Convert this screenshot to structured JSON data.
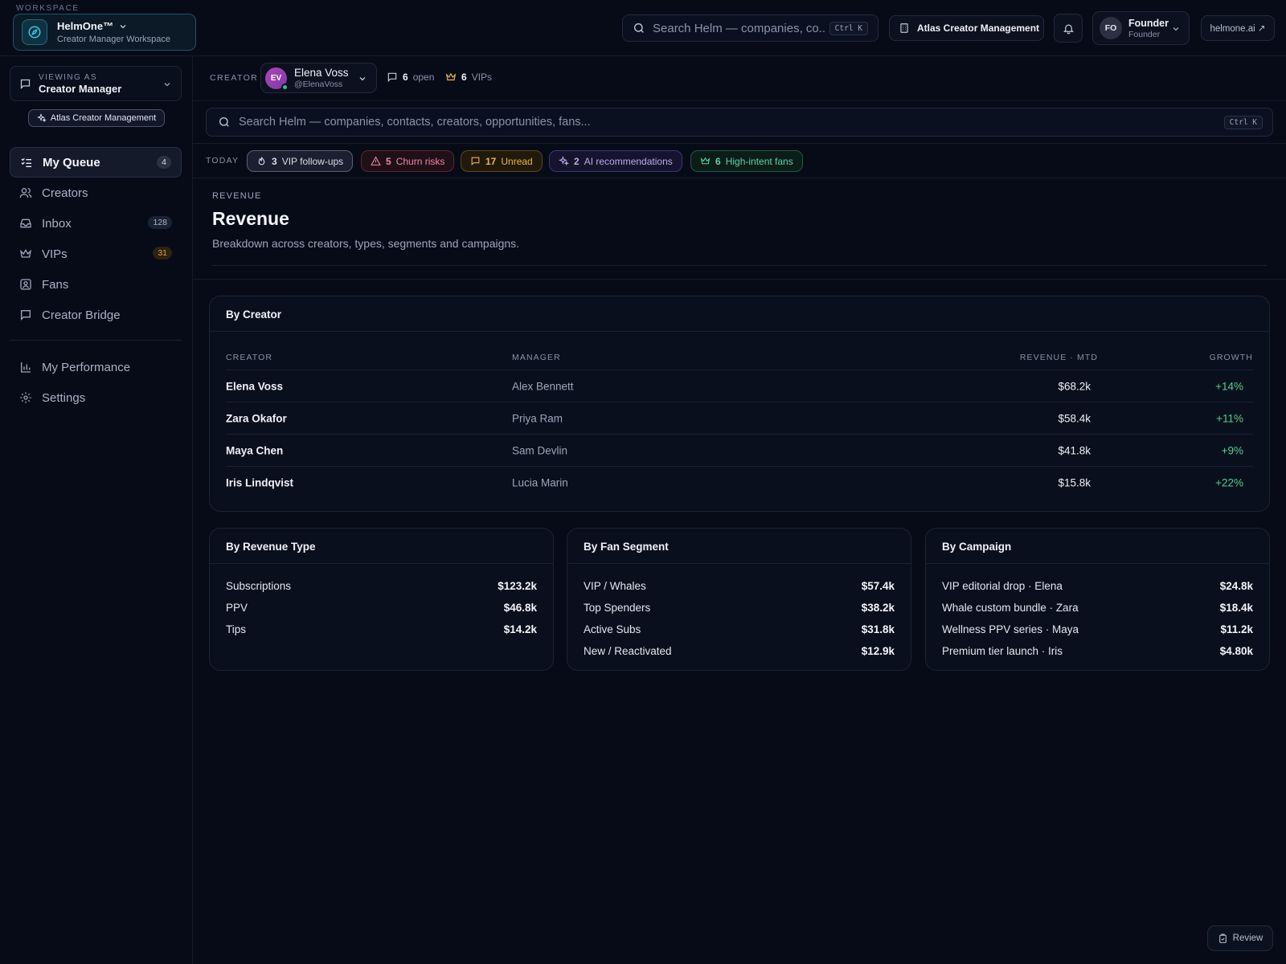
{
  "workspace": {
    "caption": "WORKSPACE",
    "name": "HelmOne™",
    "subtitle": "Creator Manager Workspace"
  },
  "topbar": {
    "search_placeholder": "Search Helm — companies, co...",
    "search_shortcut": "Ctrl K",
    "org_label": "Atlas Creator Management",
    "user_initials": "FO",
    "user_name": "Founder",
    "user_role": "Founder",
    "site_link": "helmone.ai ↗"
  },
  "sidebar": {
    "viewing_caption": "VIEWING AS",
    "viewing_role": "Creator Manager",
    "org_pill": "Atlas Creator Management",
    "nav": [
      {
        "label": "My Queue",
        "count": "4"
      },
      {
        "label": "Creators",
        "count": ""
      },
      {
        "label": "Inbox",
        "count": "128"
      },
      {
        "label": "VIPs",
        "count": "31"
      },
      {
        "label": "Fans",
        "count": ""
      },
      {
        "label": "Creator Bridge",
        "count": ""
      },
      {
        "label": "My Performance",
        "count": ""
      },
      {
        "label": "Settings",
        "count": ""
      }
    ]
  },
  "creator_bar": {
    "label": "CREATOR",
    "initials": "EV",
    "name": "Elena Voss",
    "handle": "@ElenaVoss",
    "open_count": "6",
    "open_label": "open",
    "vip_count": "6",
    "vip_label": "VIPs"
  },
  "main_search": {
    "placeholder": "Search Helm — companies, contacts, creators, opportunities, fans...",
    "shortcut": "Ctrl K"
  },
  "today": {
    "label": "TODAY",
    "chips": [
      {
        "count": "3",
        "label": "VIP follow-ups"
      },
      {
        "count": "5",
        "label": "Churn risks"
      },
      {
        "count": "17",
        "label": "Unread"
      },
      {
        "count": "2",
        "label": "AI recommendations"
      },
      {
        "count": "6",
        "label": "High-intent fans"
      }
    ]
  },
  "revenue": {
    "caption": "REVENUE",
    "title": "Revenue",
    "subtitle": "Breakdown across creators, types, segments and campaigns."
  },
  "by_creator": {
    "title": "By Creator",
    "columns": [
      "CREATOR",
      "MANAGER",
      "REVENUE · MTD",
      "GROWTH"
    ],
    "rows": [
      {
        "creator": "Elena Voss",
        "manager": "Alex Bennett",
        "revenue": "$68.2k",
        "growth": "+14%"
      },
      {
        "creator": "Zara Okafor",
        "manager": "Priya Ram",
        "revenue": "$58.4k",
        "growth": "+11%"
      },
      {
        "creator": "Maya Chen",
        "manager": "Sam Devlin",
        "revenue": "$41.8k",
        "growth": "+9%"
      },
      {
        "creator": "Iris Lindqvist",
        "manager": "Lucia Marin",
        "revenue": "$15.8k",
        "growth": "+22%"
      }
    ]
  },
  "by_type": {
    "title": "By Revenue Type",
    "rows": [
      {
        "label": "Subscriptions",
        "value": "$123.2k"
      },
      {
        "label": "PPV",
        "value": "$46.8k"
      },
      {
        "label": "Tips",
        "value": "$14.2k"
      }
    ]
  },
  "by_segment": {
    "title": "By Fan Segment",
    "rows": [
      {
        "label": "VIP / Whales",
        "value": "$57.4k"
      },
      {
        "label": "Top Spenders",
        "value": "$38.2k"
      },
      {
        "label": "Active Subs",
        "value": "$31.8k"
      },
      {
        "label": "New / Reactivated",
        "value": "$12.9k"
      }
    ]
  },
  "by_campaign": {
    "title": "By Campaign",
    "rows": [
      {
        "label": "VIP editorial drop · Elena",
        "value": "$24.8k"
      },
      {
        "label": "Whale custom bundle · Zara",
        "value": "$18.4k"
      },
      {
        "label": "Wellness PPV series · Maya",
        "value": "$11.2k"
      },
      {
        "label": "Premium tier launch · Iris",
        "value": "$4.80k"
      }
    ]
  },
  "review_button": "Review",
  "colors": {
    "background": "#070b18",
    "accent_teal": "#1e6b80",
    "growth_green": "#4fd08f",
    "amber": "#f0b545",
    "danger": "#f08a98"
  }
}
